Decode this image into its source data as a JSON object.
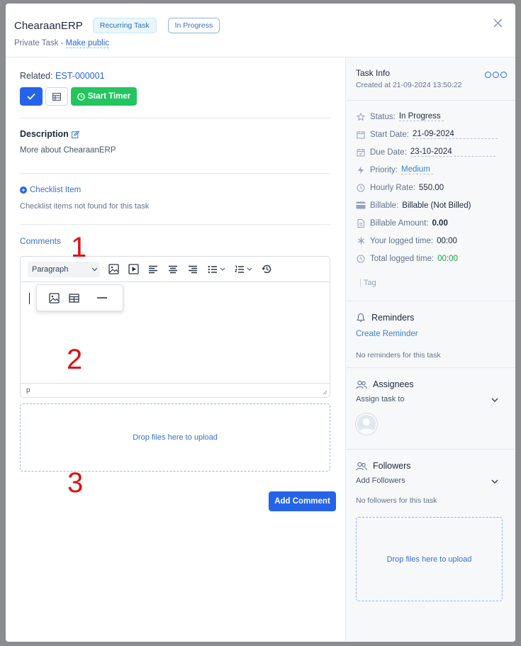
{
  "header": {
    "title": "ChearaanERP",
    "badge_recurring": "Recurring Task",
    "badge_status": "In Progress",
    "private_label": "Private Task -",
    "make_public": "Make public"
  },
  "main": {
    "related_label": "Related:",
    "related_value": "EST-000001",
    "start_timer_label": "Start Timer",
    "description_title": "Description",
    "description_text": "More about ChearaanERP",
    "checklist_title": "Checklist Item",
    "checklist_empty": "Checklist items not found for this task",
    "comments_title": "Comments",
    "editor": {
      "format_select": "Paragraph",
      "status_path": "p"
    },
    "drop_text": "Drop files here to upload",
    "add_comment_label": "Add Comment"
  },
  "annotations": [
    "1",
    "2",
    "3"
  ],
  "task_info": {
    "title": "Task Info",
    "created": "Created at 21-09-2024 13:50:22",
    "rows": [
      {
        "icon": "star-icon",
        "label": "Status:",
        "value": "In Progress"
      },
      {
        "icon": "calendar-icon",
        "label": "Start Date:",
        "value": "21-09-2024"
      },
      {
        "icon": "calendar-check-icon",
        "label": "Due Date:",
        "value": "23-10-2024"
      },
      {
        "icon": "bolt-icon",
        "label": "Priority:",
        "value": "Medium"
      },
      {
        "icon": "clock-icon",
        "label": "Hourly Rate:",
        "value": "550.00"
      },
      {
        "icon": "credit-card-icon",
        "label": "Billable:",
        "value": "Billable (Not Billed)"
      },
      {
        "icon": "file-icon",
        "label": "Billable Amount:",
        "value": "0.00"
      },
      {
        "icon": "asterisk-icon",
        "label": "Your logged time:",
        "value": "00:00"
      },
      {
        "icon": "clock-icon",
        "label": "Total logged time:",
        "value": "00:00"
      }
    ],
    "tag_placeholder": "Tag"
  },
  "reminders": {
    "title": "Reminders",
    "create": "Create Reminder",
    "empty": "No reminders for this task"
  },
  "assignees": {
    "title": "Assignees",
    "select": "Assign task to"
  },
  "followers": {
    "title": "Followers",
    "select": "Add Followers",
    "empty": "No followers for this task",
    "drop_text": "Drop files here to upload"
  },
  "colors": {
    "primary": "#2563eb",
    "success": "#22c55e",
    "annotation": "#e01010"
  }
}
